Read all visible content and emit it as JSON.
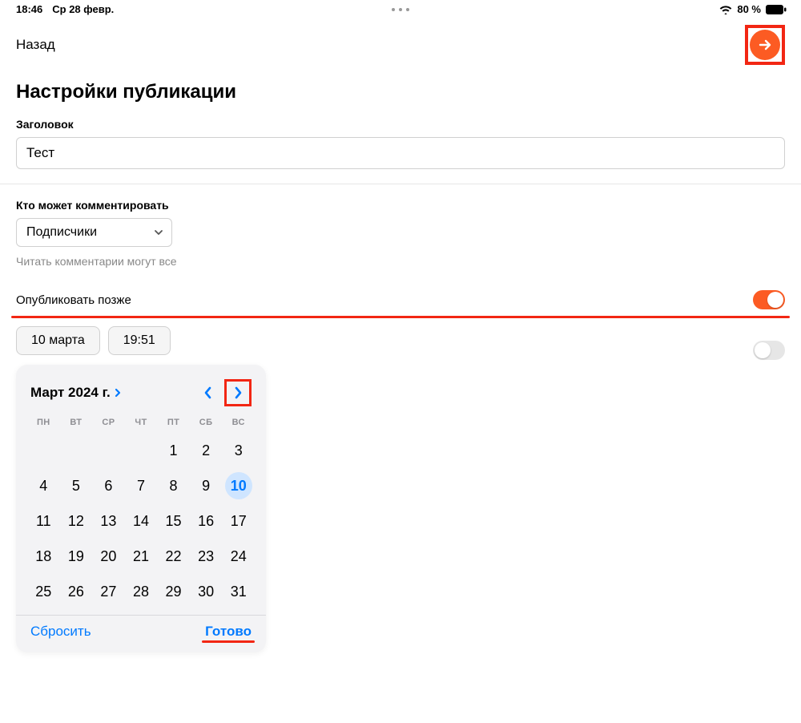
{
  "status": {
    "time": "18:46",
    "date": "Ср 28 февр.",
    "battery": "80 %"
  },
  "nav": {
    "back": "Назад"
  },
  "page": {
    "title": "Настройки публикации"
  },
  "titleField": {
    "label": "Заголовок",
    "value": "Тест"
  },
  "comments": {
    "label": "Кто может комментировать",
    "selected": "Подписчики",
    "hint": "Читать комментарии могут все"
  },
  "schedule": {
    "label": "Опубликовать позже",
    "enabled": true,
    "date_pill": "10 марта",
    "time_pill": "19:51"
  },
  "secondary_toggle": {
    "enabled": false
  },
  "calendar": {
    "title": "Март 2024 г.",
    "dow": [
      "ПН",
      "ВТ",
      "СР",
      "ЧТ",
      "ПТ",
      "СБ",
      "ВС"
    ],
    "leading_blanks": 4,
    "days": [
      1,
      2,
      3,
      4,
      5,
      6,
      7,
      8,
      9,
      10,
      11,
      12,
      13,
      14,
      15,
      16,
      17,
      18,
      19,
      20,
      21,
      22,
      23,
      24,
      25,
      26,
      27,
      28,
      29,
      30,
      31
    ],
    "selected_day": 10,
    "reset": "Сбросить",
    "done": "Готово"
  }
}
